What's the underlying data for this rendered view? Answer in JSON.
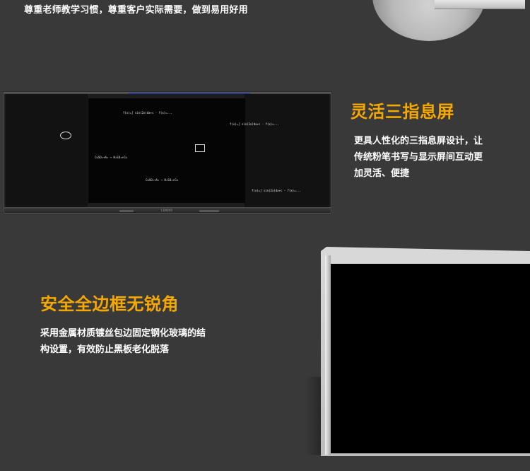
{
  "header": {
    "tagline": "尊重老师教学习惯，尊重客户实际需要，做到易用好用"
  },
  "board": {
    "logo": "LENOVO",
    "chalk": [
      "f(x)=∫ sin(2x)dx+c  ·  f(x)=...",
      "f(x)=∫ sin(2x)dx+c  ·  f(x)=...",
      "f(x)=∫ sin(2x)dx+c  ·  f(x)=...",
      "CuSO₄+A₂ → H₂SO₄+Cu",
      "CuSO₄+A₂ → H₂SO₄+Cu"
    ]
  },
  "features": [
    {
      "title": "灵活三指息屏",
      "description_lines": [
        "更具人性化的三指息屏设计，让",
        "传统粉笔书写与显示屏间互动更",
        "加灵活、便捷"
      ]
    },
    {
      "title": "安全全边框无锐角",
      "description_lines": [
        "采用金属材质镀丝包边固定钢化玻璃的结",
        "构设置，有效防止黑板老化脱落"
      ]
    }
  ],
  "colors": {
    "background": "#393939",
    "accent": "#f5a800",
    "text": "#ffffff"
  }
}
